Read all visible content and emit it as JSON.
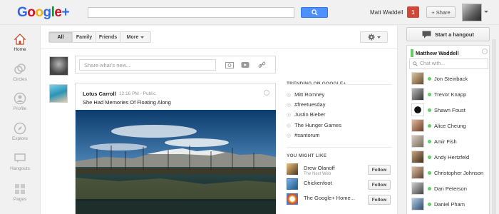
{
  "header": {
    "logo": {
      "g": "G",
      "o1": "o",
      "o2": "o",
      "g2": "g",
      "l": "l",
      "e": "e",
      "plus": "+"
    },
    "search_placeholder": "",
    "username": "Matt Waddell",
    "notification_count": "1",
    "share_label": "Share"
  },
  "leftnav": {
    "items": [
      {
        "label": "Home",
        "icon": "home-icon"
      },
      {
        "label": "Circles",
        "icon": "circles-icon"
      },
      {
        "label": "Profile",
        "icon": "profile-icon"
      },
      {
        "label": "Explore",
        "icon": "compass-icon"
      },
      {
        "label": "Hangouts",
        "icon": "hangouts-icon"
      },
      {
        "label": "Pages",
        "icon": "pages-icon"
      }
    ]
  },
  "stream": {
    "filters": [
      "All",
      "Family",
      "Friends",
      "More"
    ],
    "selected_filter": "All",
    "share_placeholder": "Share what's new...",
    "post": {
      "author": "Lotus Carroll",
      "time": "12:16 PM",
      "visibility": "Public",
      "title": "She Had Memories Of Floating Along"
    }
  },
  "trending": {
    "title": "TRENDING ON GOOGLE+",
    "items": [
      "Mitt Romney",
      "#freetuesday",
      "Justin Bieber",
      "The Hunger Games",
      "#santorum"
    ]
  },
  "you_might_like": {
    "title": "YOU MIGHT LIKE",
    "follow_label": "Follow",
    "items": [
      {
        "name": "Drew Olanoff",
        "sub": "The Next Web"
      },
      {
        "name": "Chickenfoot",
        "sub": ""
      },
      {
        "name": "The Google+ Home...",
        "sub": ""
      }
    ]
  },
  "rightpanel": {
    "hangout_label": "Start a hangout",
    "chat_owner": "Matthew Waddell",
    "chat_placeholder": "Chat with...",
    "contacts": [
      "Jon Steinback",
      "Trevor Knapp",
      "Shawn Foust",
      "Alice Cheung",
      "Amir Fish",
      "Andy Hertzfeld",
      "Christopher Johnson",
      "Dan Peterson",
      "Daniel Pham"
    ]
  },
  "colors": {
    "accent": "#4d90fe",
    "notification": "#d14836",
    "online": "#66cc66"
  }
}
